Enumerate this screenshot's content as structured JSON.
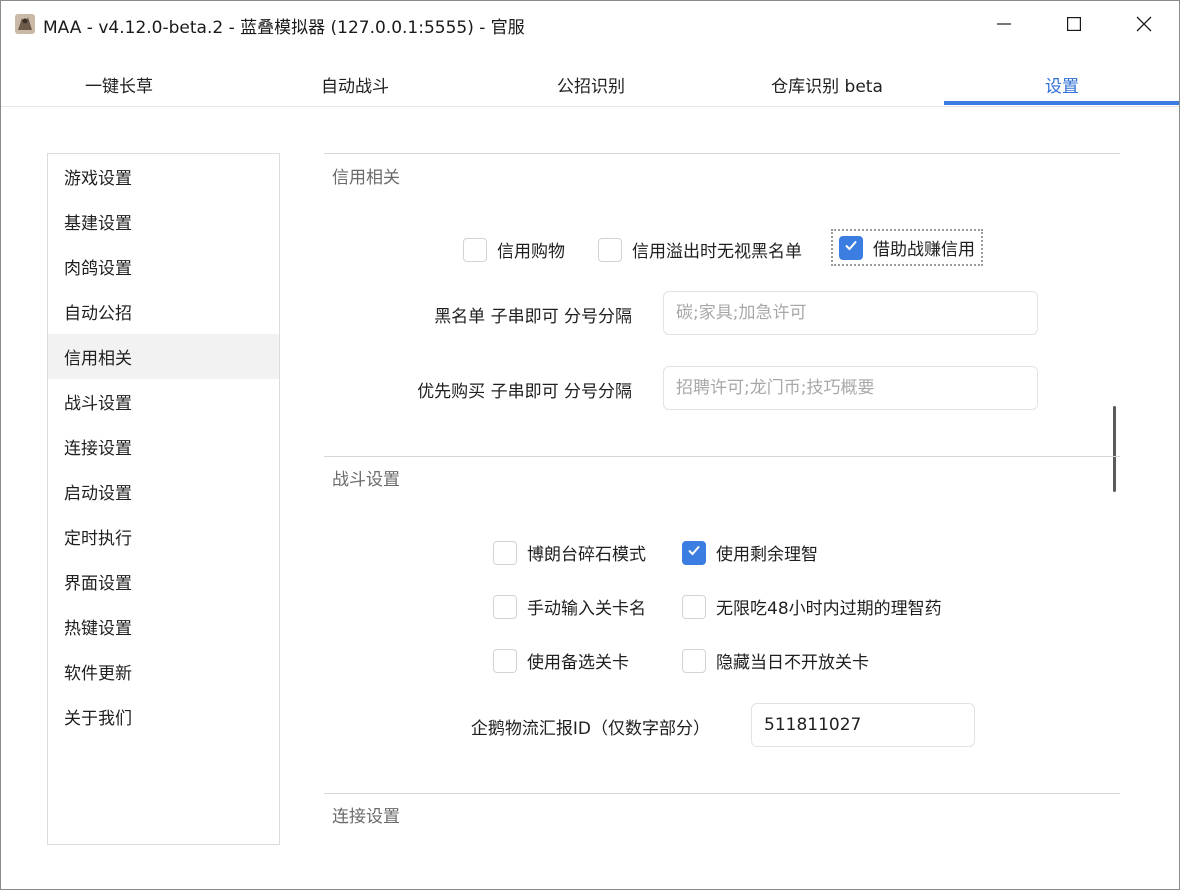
{
  "window": {
    "title": "MAA - v4.12.0-beta.2 - 蓝叠模拟器 (127.0.0.1:5555) - 官服",
    "controls": [
      "minimize-icon",
      "maximize-icon",
      "close-icon"
    ]
  },
  "tabs": [
    {
      "label": "一键长草"
    },
    {
      "label": "自动战斗"
    },
    {
      "label": "公招识别"
    },
    {
      "label": "仓库识别 beta"
    },
    {
      "label": "设置",
      "active": true
    }
  ],
  "sidebar": {
    "items": [
      {
        "label": "游戏设置"
      },
      {
        "label": "基建设置"
      },
      {
        "label": "肉鸽设置"
      },
      {
        "label": "自动公招"
      },
      {
        "label": "信用相关",
        "selected": true
      },
      {
        "label": "战斗设置"
      },
      {
        "label": "连接设置"
      },
      {
        "label": "启动设置"
      },
      {
        "label": "定时执行"
      },
      {
        "label": "界面设置"
      },
      {
        "label": "热键设置"
      },
      {
        "label": "软件更新"
      },
      {
        "label": "关于我们"
      }
    ]
  },
  "credit": {
    "title": "信用相关",
    "options": [
      {
        "label": "信用购物",
        "checked": false
      },
      {
        "label": "信用溢出时无视黑名单",
        "checked": false
      },
      {
        "label": "借助战赚信用",
        "checked": true
      }
    ],
    "blacklist_label": "黑名单 子串即可 分号分隔",
    "blacklist_placeholder": "碳;家具;加急许可",
    "priority_label": "优先购买 子串即可 分号分隔",
    "priority_placeholder": "招聘许可;龙门币;技巧概要"
  },
  "battle": {
    "title": "战斗设置",
    "options": [
      {
        "label": "博朗台碎石模式",
        "checked": false
      },
      {
        "label": "使用剩余理智",
        "checked": true
      },
      {
        "label": "手动输入关卡名",
        "checked": false
      },
      {
        "label": "无限吃48小时内过期的理智药",
        "checked": false
      },
      {
        "label": "使用备选关卡",
        "checked": false
      },
      {
        "label": "隐藏当日不开放关卡",
        "checked": false
      }
    ],
    "penguin_label": "企鹅物流汇报ID（仅数字部分）",
    "penguin_value": "511811027"
  },
  "connection": {
    "title": "连接设置"
  },
  "colors": {
    "accent": "#3b7de0",
    "section_title": "#6b6b6b"
  }
}
